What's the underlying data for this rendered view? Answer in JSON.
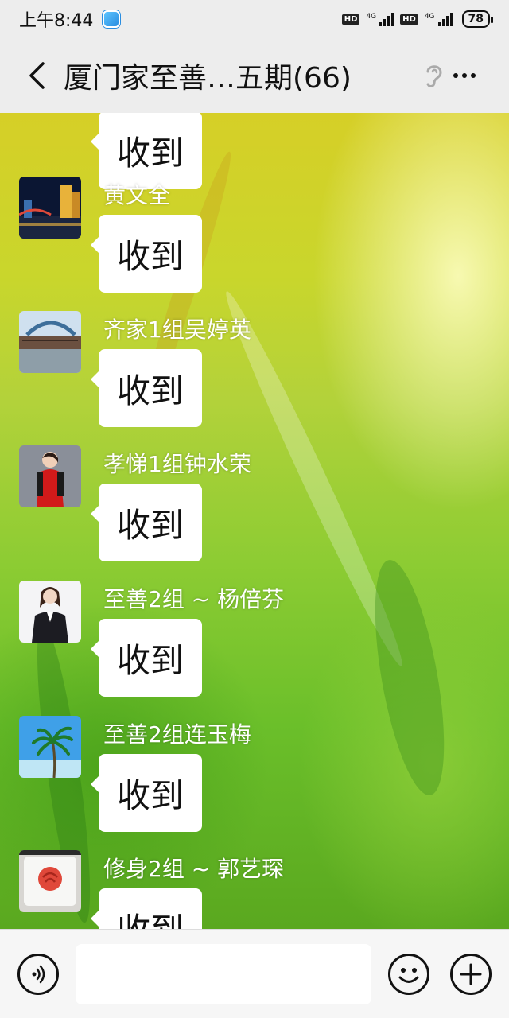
{
  "status_bar": {
    "time": "上午8:44",
    "hd_label": "HD",
    "network_label": "4G",
    "battery": "78"
  },
  "header": {
    "title": "厦门家至善…五期(66)"
  },
  "messages": [
    {
      "sender": "",
      "text": "收到",
      "avatar": "partial"
    },
    {
      "sender": "黄文全",
      "text": "收到",
      "avatar": "night-city"
    },
    {
      "sender": "齐家1组吴婷英",
      "text": "收到",
      "avatar": "bridge"
    },
    {
      "sender": "孝悌1组钟水荣",
      "text": "收到",
      "avatar": "woman-red-dress"
    },
    {
      "sender": "至善2组 ~ 杨倍芬",
      "text": "收到",
      "avatar": "woman-suit"
    },
    {
      "sender": "至善2组连玉梅",
      "text": "收到",
      "avatar": "palm-tree"
    },
    {
      "sender": "修身2组 ~ 郭艺琛",
      "text": "收到",
      "avatar": "rose"
    }
  ],
  "input_bar": {
    "value": "",
    "icons": [
      "voice-icon",
      "emoji-icon",
      "plus-icon"
    ]
  }
}
